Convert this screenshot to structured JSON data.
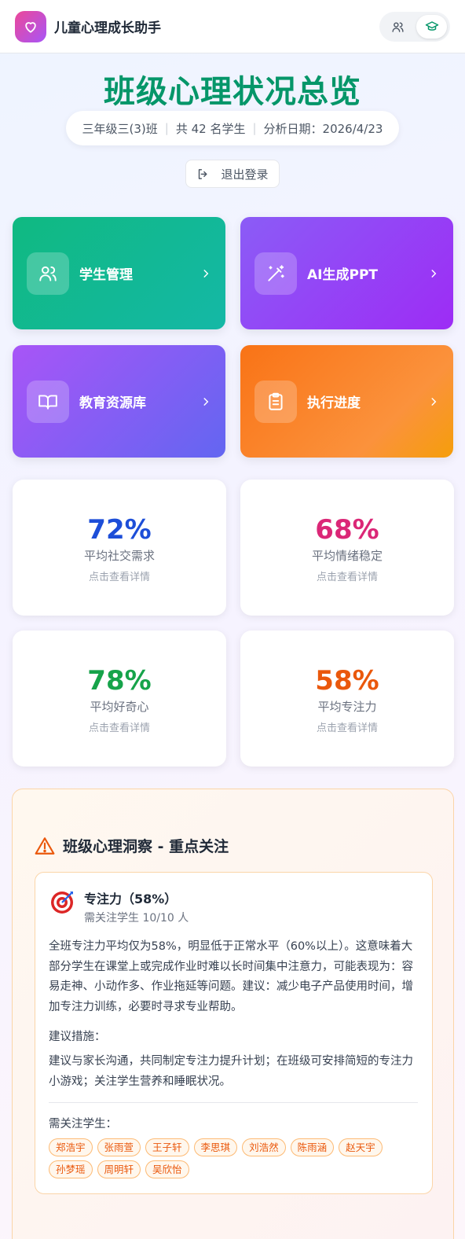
{
  "header": {
    "app_title": "儿童心理成长助手",
    "logo_icon": "heart-icon",
    "toggle": [
      {
        "icon": "users-icon",
        "active": false
      },
      {
        "icon": "graduation-cap-icon",
        "active": true
      }
    ]
  },
  "overview": {
    "title": "班级心理状况总览",
    "class_name": "三年级三(3)班",
    "student_count": "共 42 名学生",
    "analysis_date": "分析日期：2026/4/23",
    "logout_label": "退出登录"
  },
  "actions": [
    {
      "label": "学生管理",
      "icon": "users-icon",
      "color": "#10b981"
    },
    {
      "label": "AI生成PPT",
      "icon": "magic-wand-icon",
      "color": "#8b5cf6"
    },
    {
      "label": "教育资源库",
      "icon": "book-open-icon",
      "color": "#a855f7"
    },
    {
      "label": "执行进度",
      "icon": "clipboard-icon",
      "color": "#f97316"
    }
  ],
  "stats": [
    {
      "value": "72%",
      "name": "平均社交需求",
      "hint": "点击查看详情",
      "color": "#1d4ed8"
    },
    {
      "value": "68%",
      "name": "平均情绪稳定",
      "hint": "点击查看详情",
      "color": "#db2777"
    },
    {
      "value": "78%",
      "name": "平均好奇心",
      "hint": "点击查看详情",
      "color": "#16a34a"
    },
    {
      "value": "58%",
      "name": "平均专注力",
      "hint": "点击查看详情",
      "color": "#ea580c"
    }
  ],
  "insight": {
    "title": "班级心理洞察 - 重点关注",
    "item_title": "专注力（58%）",
    "item_sub": "需关注学生 10/10 人",
    "description": "全班专注力平均仅为58%，明显低于正常水平（60%以上）。这意味着大部分学生在课堂上或完成作业时难以长时间集中注意力，可能表现为：容易走神、小动作多、作业拖延等问题。建议：减少电子产品使用时间，增加专注力训练，必要时寻求专业帮助。",
    "measures_label": "建议措施：",
    "measures": "建议与家长沟通，共同制定专注力提升计划；在班级可安排简短的专注力小游戏；关注学生营养和睡眠状况。",
    "students_label": "需关注学生：",
    "students": [
      "郑浩宇",
      "张雨萱",
      "王子轩",
      "李思琪",
      "刘浩然",
      "陈雨涵",
      "赵天宇",
      "孙梦瑶",
      "周明轩",
      "吴欣怡"
    ]
  }
}
